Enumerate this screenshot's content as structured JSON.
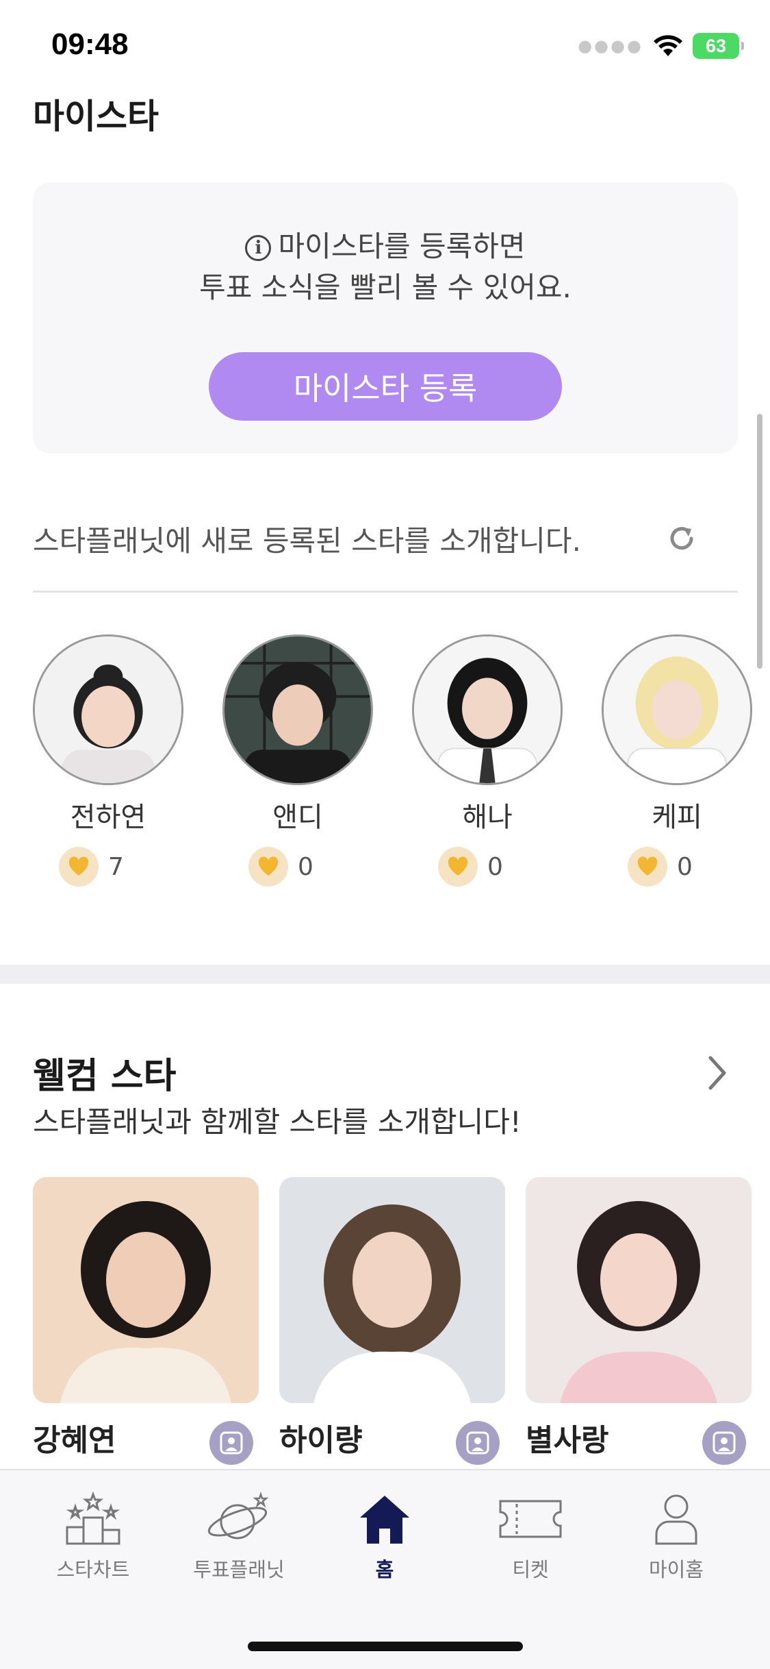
{
  "status_bar": {
    "time": "09:48",
    "battery": "63"
  },
  "my_star": {
    "title": "마이스타",
    "info_line1": "마이스타를 등록하면",
    "info_line2": "투표 소식을 빨리 볼 수 있어요.",
    "info_symbol": "i",
    "register_button": "마이스타 등록"
  },
  "new_stars": {
    "intro": "스타플래닛에 새로 등록된 스타를 소개합니다.",
    "items": [
      {
        "name": "전하연",
        "votes": "7"
      },
      {
        "name": "앤디",
        "votes": "0"
      },
      {
        "name": "해나",
        "votes": "0"
      },
      {
        "name": "케피",
        "votes": "0"
      }
    ]
  },
  "welcome_star": {
    "title": "웰컴 스타",
    "subtitle": "스타플래닛과 함께할 스타를 소개합니다!",
    "cards": [
      {
        "name": "강혜연"
      },
      {
        "name": "하이량"
      },
      {
        "name": "별사랑"
      }
    ]
  },
  "tab_bar": {
    "tabs": [
      {
        "label": "스타차트",
        "icon": "podium-icon"
      },
      {
        "label": "투표플래닛",
        "icon": "planet-icon"
      },
      {
        "label": "홈",
        "icon": "home-icon"
      },
      {
        "label": "티켓",
        "icon": "ticket-icon"
      },
      {
        "label": "마이홈",
        "icon": "person-icon"
      }
    ],
    "active": "홈"
  },
  "colors": {
    "accent_purple": "#b08af0",
    "heart": "#f2b630",
    "heart_bg": "#f6e3c3",
    "tab_active": "#131a55",
    "badge": "#a6a1c4"
  }
}
